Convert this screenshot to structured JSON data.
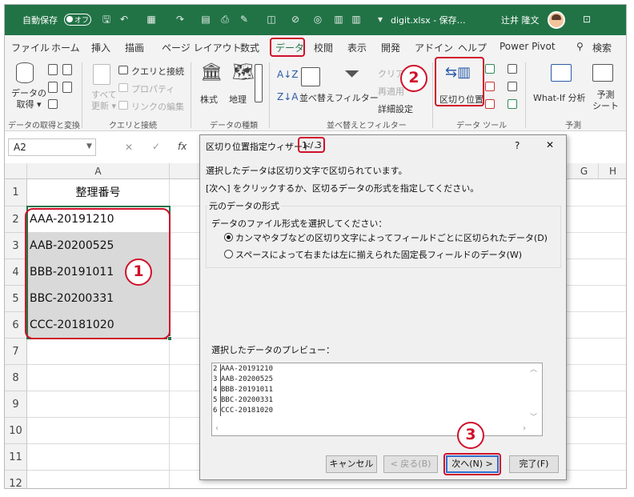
{
  "titlebar": {
    "autosave_label": "自動保存",
    "autosave_state": "オフ",
    "filename": "digit.xlsx  -  保存…",
    "user": "辻井 隆文"
  },
  "menu_tabs": [
    {
      "label": "ファイル"
    },
    {
      "label": "ホーム"
    },
    {
      "label": "挿入"
    },
    {
      "label": "描画"
    },
    {
      "label": "ページ レイアウト"
    },
    {
      "label": "数式"
    },
    {
      "label": "データ"
    },
    {
      "label": "校閲"
    },
    {
      "label": "表示"
    },
    {
      "label": "開発"
    },
    {
      "label": "アドイン"
    },
    {
      "label": "ヘルプ"
    },
    {
      "label": "Power Pivot"
    },
    {
      "label": "検索"
    }
  ],
  "ribbon": {
    "get_data_label": "データの\n取得 ▾",
    "refresh_all_label": "すべて\n更新 ▾",
    "queries_connections": "クエリと接続",
    "properties": "プロパティ",
    "edit_links": "リンクの編集",
    "stocks": "株式",
    "geography": "地理",
    "sort": "並べ替え",
    "filter": "フィルター",
    "clear": "クリア",
    "reapply": "再適用",
    "advanced": "詳細設定",
    "text_to_columns": "区切り位置",
    "whatif": "What-If 分析",
    "forecast_sheet": "予測\nシート",
    "groups": {
      "get_transform": "データの取得と変換",
      "queries": "クエリと接続",
      "data_types": "データの種類",
      "sort_filter": "並べ替えとフィルター",
      "data_tools": "データ ツール",
      "forecast": "予測"
    }
  },
  "formula_bar": {
    "name_box": "A2",
    "fx": "fx"
  },
  "sheet": {
    "columns": [
      "A",
      "G",
      "H"
    ],
    "rows": [
      "1",
      "2",
      "3",
      "4",
      "5",
      "6",
      "7",
      "8",
      "9",
      "10",
      "11",
      "12"
    ],
    "header_cell": "整理番号",
    "cells": [
      "AAA-20191210",
      "AAB-20200525",
      "BBB-20191011",
      "BBC-20200331",
      "CCC-20181020"
    ]
  },
  "annotations": {
    "step1": "1",
    "step2": "2",
    "step3": "3"
  },
  "dialog": {
    "title": "区切り位置指定ウィザード -",
    "step": "1 / 3",
    "help": "?",
    "close": "✕",
    "desc1": "選択したデータは区切り文字で区切られています。",
    "desc2": "[次へ] をクリックするか、区切るデータの形式を指定してください。",
    "group_label": "元のデータの形式",
    "choose_label": "データのファイル形式を選択してください：",
    "option_delimited": "カンマやタブなどの区切り文字によってフィールドごとに区切られたデータ(D)",
    "option_fixed": "スペースによって右または左に揃えられた固定長フィールドのデータ(W)",
    "preview_label": "選択したデータのプレビュー：",
    "preview_rows": [
      {
        "n": "2",
        "text": "AAA-20191210"
      },
      {
        "n": "3",
        "text": "AAB-20200525"
      },
      {
        "n": "4",
        "text": "BBB-20191011"
      },
      {
        "n": "5",
        "text": "BBC-20200331"
      },
      {
        "n": "6",
        "text": "CCC-20181020"
      }
    ],
    "buttons": {
      "cancel": "キャンセル",
      "back": "< 戻る(B)",
      "next": "次へ(N) >",
      "finish": "完了(F)"
    }
  },
  "colors": {
    "excel_green": "#217346",
    "annotation_red": "#d0102a",
    "selection_gray": "#d9d9d9"
  }
}
